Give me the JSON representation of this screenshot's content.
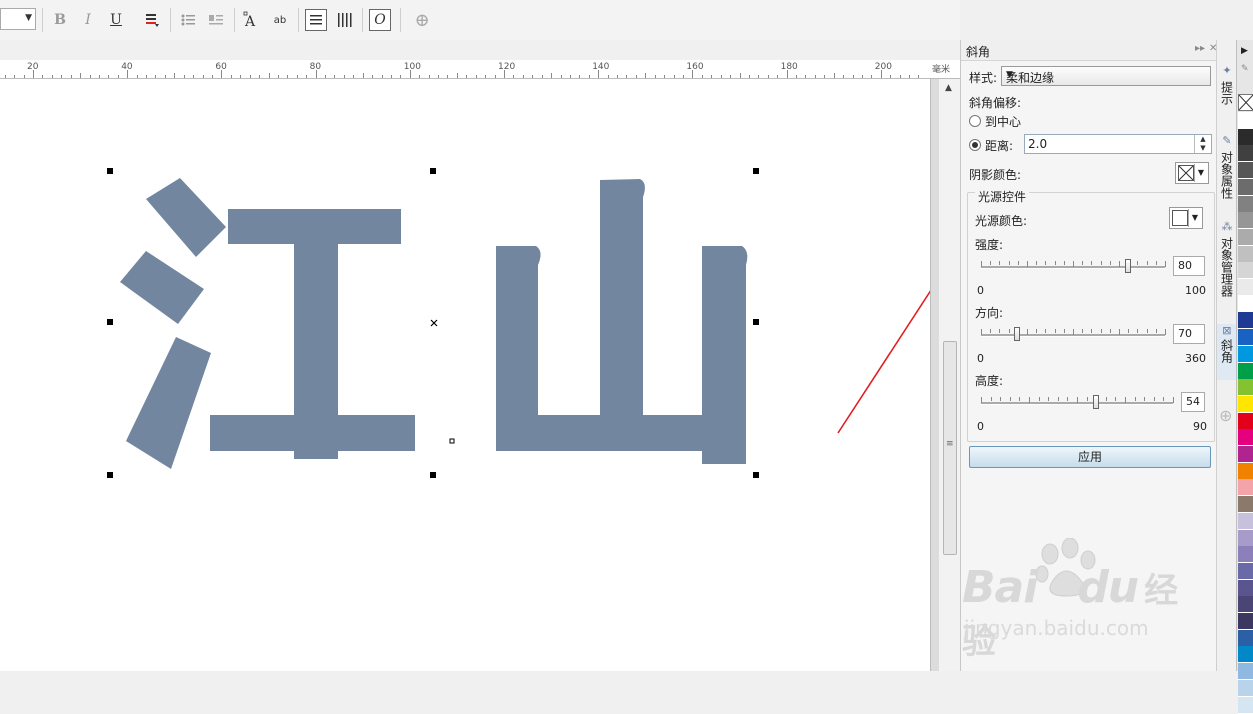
{
  "toolbar": {
    "buttons": [
      {
        "name": "bold-button",
        "glyph": "B"
      },
      {
        "name": "italic-button",
        "glyph": "I"
      },
      {
        "name": "underline-button",
        "glyph": "U"
      },
      {
        "name": "text-color-button",
        "glyph": "≡"
      },
      {
        "name": "bullet-list-button",
        "glyph": "☰"
      },
      {
        "name": "drop-cap-button",
        "glyph": "▤"
      },
      {
        "name": "character-formatting-button",
        "glyph": "A"
      },
      {
        "name": "edit-text-button",
        "glyph": "ab"
      },
      {
        "name": "horizontal-text-button",
        "glyph": "☰"
      },
      {
        "name": "vertical-text-button",
        "glyph": "Ⅲ"
      },
      {
        "name": "object-properties-button",
        "glyph": "O"
      },
      {
        "name": "add-toolbar-button",
        "glyph": "⊕"
      }
    ]
  },
  "ruler": {
    "labels": [
      "20",
      "40",
      "60",
      "80",
      "100",
      "120",
      "140",
      "160",
      "180",
      "200"
    ],
    "unit": "毫米"
  },
  "canvas": {
    "text": "江山",
    "text_color": "#7286a0"
  },
  "docker": {
    "title": "斜角",
    "style_label": "样式:",
    "style_value": "柔和边缘",
    "offset_label": "斜角偏移:",
    "to_center_label": "到中心",
    "distance_label": "距离:",
    "distance_value": "2.0",
    "shadow_color_label": "阴影颜色:",
    "light_group_title": "光源控件",
    "light_color_label": "光源颜色:",
    "intensity": {
      "label": "强度:",
      "value": "80",
      "min": "0",
      "max": "100",
      "level": 80
    },
    "direction": {
      "label": "方向:",
      "value": "70",
      "min": "0",
      "max": "360",
      "level": 70
    },
    "altitude": {
      "label": "高度:",
      "value": "54",
      "min": "0",
      "max": "90",
      "level": 54
    },
    "apply_label": "应用"
  },
  "side_tabs": [
    {
      "label": "提示",
      "icon": "hint-icon"
    },
    {
      "label": "对象属性",
      "icon": "object-properties-icon"
    },
    {
      "label": "对象管理器",
      "icon": "object-manager-icon"
    },
    {
      "label": "斜角",
      "icon": "bevel-icon"
    }
  ],
  "palette": {
    "colors": [
      "#ffffff",
      "#2b2b2b",
      "#404040",
      "#575757",
      "#6c6c6c",
      "#818181",
      "#969696",
      "#ababab",
      "#c0c0c0",
      "#d5d5d5",
      "#eaeaea",
      "#ffffff",
      "#1f3a93",
      "#1a62c2",
      "#0099e0",
      "#00a04b",
      "#84c232",
      "#ffe600",
      "#e2001a",
      "#e4007f",
      "#b0248f",
      "#f08200",
      "#f4a3a8",
      "#8b7a6b",
      "#c7c1de",
      "#a79bc9",
      "#8b80b9",
      "#6b6aa8",
      "#5a548f",
      "#4a4574",
      "#3b3760",
      "#2b5fa6",
      "#0088c8",
      "#8fb9e0",
      "#b8d3ea",
      "#d6e5f2"
    ]
  },
  "annotation": {
    "arrow_color": "#e02020"
  },
  "watermark": {
    "brand": "Bai",
    "brand2": "du",
    "product": "经验",
    "url": "jingyan.baidu.com"
  }
}
